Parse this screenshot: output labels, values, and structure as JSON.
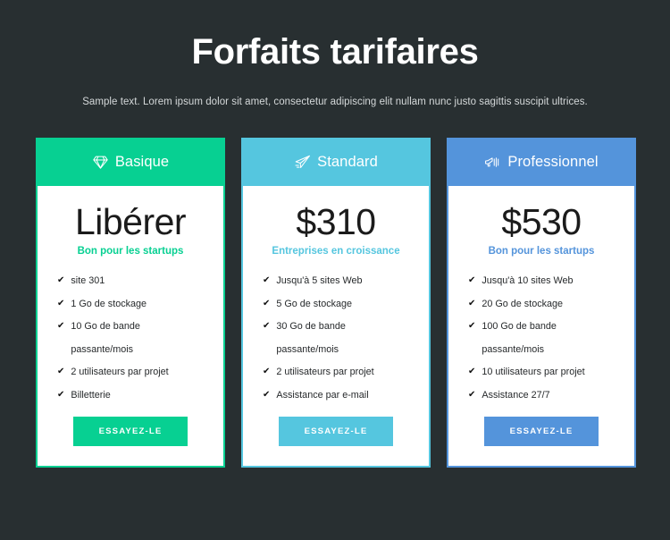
{
  "header": {
    "title": "Forfaits tarifaires",
    "subtitle": "Sample text. Lorem ipsum dolor sit amet, consectetur adipiscing elit nullam nunc justo sagittis suscipit ultrices."
  },
  "theme": {
    "background": "#282f31",
    "title_color": "#ffffff",
    "subtitle_color": "#d4d8d9",
    "card_background": "#ffffff",
    "price_color": "#1b1b1b",
    "feature_color": "#26292b"
  },
  "plans": [
    {
      "name": "Basique",
      "icon": "diamond-icon",
      "color": "#07d092",
      "price": "Libérer",
      "tagline": "Bon pour les startups",
      "features": [
        {
          "text": "site 301",
          "check": true
        },
        {
          "text": "1 Go de stockage",
          "check": true
        },
        {
          "text": "10 Go de bande",
          "check": true
        },
        {
          "text": "passante/mois",
          "check": false
        },
        {
          "text": "2 utilisateurs par projet",
          "check": true
        },
        {
          "text": "Billetterie",
          "check": true
        }
      ],
      "cta_label": "ESSAYEZ-LE"
    },
    {
      "name": "Standard",
      "icon": "paper-plane-icon",
      "color": "#55c6df",
      "price": "$310",
      "tagline": "Entreprises en croissance",
      "features": [
        {
          "text": "Jusqu'à 5 sites Web",
          "check": true
        },
        {
          "text": "5 Go de stockage",
          "check": true
        },
        {
          "text": "30 Go de bande",
          "check": true
        },
        {
          "text": "passante/mois",
          "check": false
        },
        {
          "text": "2 utilisateurs par projet",
          "check": true
        },
        {
          "text": "Assistance par e-mail",
          "check": true
        }
      ],
      "cta_label": "ESSAYEZ-LE"
    },
    {
      "name": "Professionnel",
      "icon": "megaphone-icon",
      "color": "#5494db",
      "price": "$530",
      "tagline": "Bon pour les startups",
      "features": [
        {
          "text": "Jusqu'à 10 sites Web",
          "check": true
        },
        {
          "text": "20 Go de stockage",
          "check": true
        },
        {
          "text": "100 Go de bande",
          "check": true
        },
        {
          "text": "passante/mois",
          "check": false
        },
        {
          "text": "10 utilisateurs par projet",
          "check": true
        },
        {
          "text": "Assistance 27/7",
          "check": true
        }
      ],
      "cta_label": "ESSAYEZ-LE"
    }
  ],
  "icons": {
    "check": "✔"
  }
}
